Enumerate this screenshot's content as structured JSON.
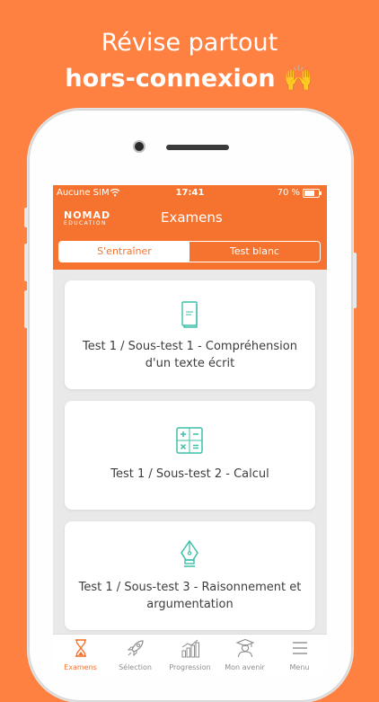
{
  "promo": {
    "line1": "Révise partout",
    "line2": "hors-connexion 🙌"
  },
  "status": {
    "carrier": "Aucune SIM",
    "time": "17:41",
    "battery": "70 %"
  },
  "app": {
    "logo_main": "NOMAD",
    "logo_sub": "EDUCATION",
    "title": "Examens"
  },
  "segments": [
    {
      "label": "S'entraîner",
      "active": true
    },
    {
      "label": "Test blanc",
      "active": false
    }
  ],
  "cards": [
    {
      "icon": "book-icon",
      "label": "Test 1 / Sous-test 1 - Compréhension d'un texte écrit"
    },
    {
      "icon": "calculator-icon",
      "label": "Test 1 / Sous-test 2 - Calcul"
    },
    {
      "icon": "fountain-pen-icon",
      "label": "Test 1 / Sous-test 3 - Raisonnement et argumentation"
    }
  ],
  "tabs": [
    {
      "icon": "hourglass-icon",
      "label": "Examens",
      "active": true
    },
    {
      "icon": "rocket-icon",
      "label": "Sélection",
      "active": false
    },
    {
      "icon": "bar-chart-icon",
      "label": "Progression",
      "active": false
    },
    {
      "icon": "graduate-icon",
      "label": "Mon avenir",
      "active": false
    },
    {
      "icon": "menu-icon",
      "label": "Menu",
      "active": false
    }
  ],
  "colors": {
    "background": "#ff8142",
    "accent": "#f5732e",
    "icon_teal": "#3dbfa8"
  }
}
